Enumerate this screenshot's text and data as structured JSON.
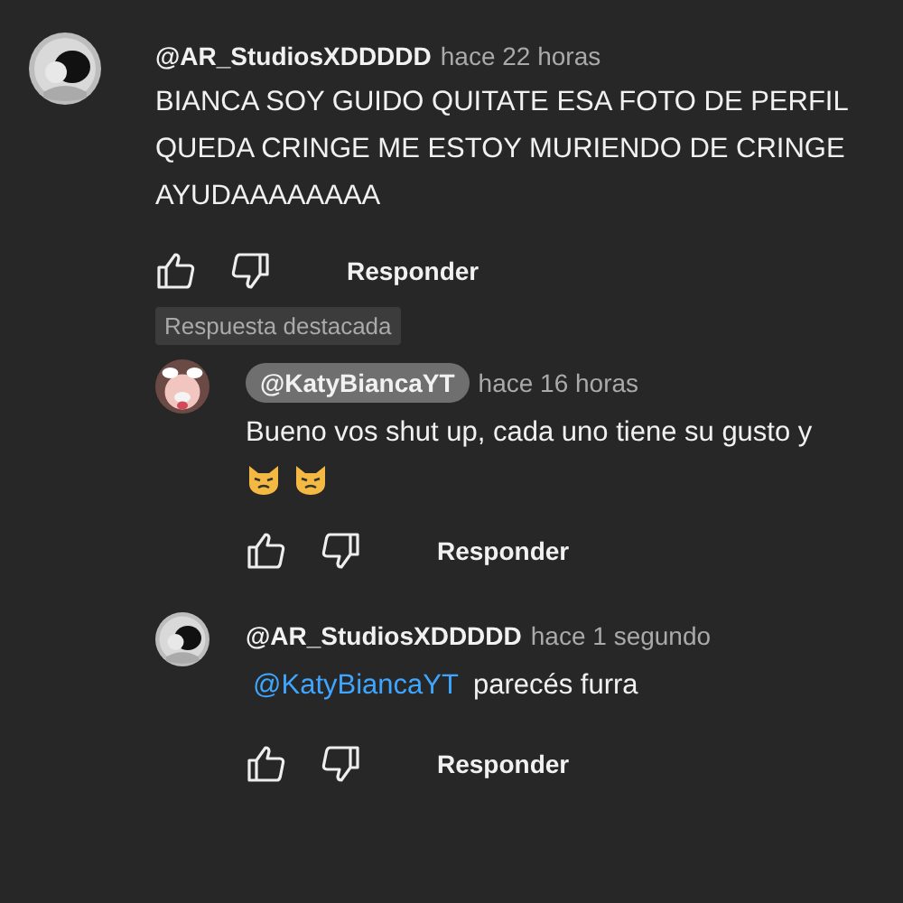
{
  "comment": {
    "author": "@AR_StudiosXDDDDD",
    "author_highlighted": false,
    "time": "hace 22 horas",
    "lines": [
      "BIANCA SOY GUIDO QUITATE ESA FOTO DE PERFIL",
      "QUEDA CRINGE ME ESTOY MURIENDO DE CRINGE",
      "AYUDAAAAAAAA"
    ],
    "reply_button": "Responder",
    "badge": "Respuesta destacada"
  },
  "replies": [
    {
      "author": "@KatyBiancaYT",
      "author_highlighted": true,
      "time": "hace 16 horas",
      "text": "Bueno vos shut up, cada uno tiene su gusto y",
      "emojis": [
        {
          "kind": "pouting_cat"
        },
        {
          "kind": "pouting_cat"
        }
      ],
      "reply_button": "Responder"
    },
    {
      "author": "@AR_StudiosXDDDDD",
      "author_highlighted": false,
      "time": "hace 1 segundo",
      "mention": "@KatyBiancaYT",
      "text": "parecés furra",
      "reply_button": "Responder"
    }
  ]
}
